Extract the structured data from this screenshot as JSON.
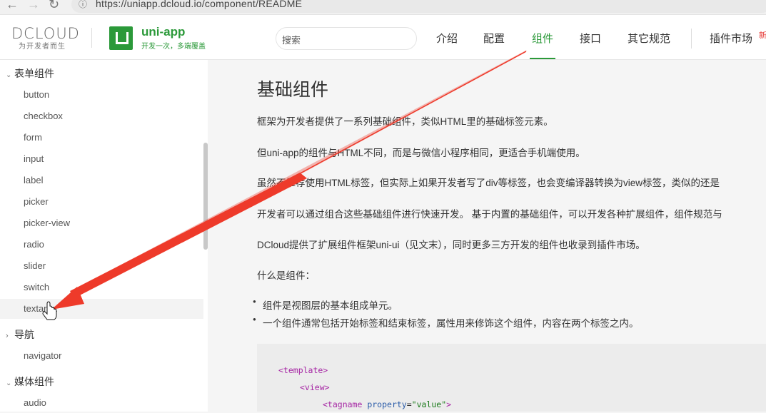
{
  "browser": {
    "url": "https://uniapp.dcloud.io/component/README"
  },
  "header": {
    "dcloud_logo": "DCLOUD",
    "dcloud_tagline": "为开发者而生",
    "uni_title": "uni-app",
    "uni_sub": "开发一次，多端覆盖",
    "search_placeholder": "搜索",
    "nav": [
      {
        "label": "介绍"
      },
      {
        "label": "配置"
      },
      {
        "label": "组件"
      },
      {
        "label": "接口"
      },
      {
        "label": "其它规范"
      },
      {
        "label": "插件市场"
      }
    ],
    "nav_badge": "新",
    "accent_color": "#2b9939"
  },
  "sidebar": {
    "groups": [
      {
        "title": "表单组件",
        "items": [
          "button",
          "checkbox",
          "form",
          "input",
          "label",
          "picker",
          "picker-view",
          "radio",
          "slider",
          "switch",
          "textarea"
        ]
      },
      {
        "title": "导航",
        "items": [
          "navigator"
        ]
      },
      {
        "title": "媒体组件",
        "items": [
          "audio"
        ]
      }
    ]
  },
  "main": {
    "title": "基础组件",
    "paragraphs": [
      "框架为开发者提供了一系列基础组件，类似HTML里的基础标签元素。",
      "但uni-app的组件与HTML不同，而是与微信小程序相同，更适合手机端使用。",
      "虽然不推荐使用HTML标签，但实际上如果开发者写了div等标签，也会变编译器转换为view标签，类似的还是",
      "开发者可以通过组合这些基础组件进行快速开发。 基于内置的基础组件，可以开发各种扩展组件，组件规范与",
      "DCloud提供了扩展组件框架uni-ui（见文末），同时更多三方开发的组件也收录到插件市场。",
      "什么是组件："
    ],
    "bullets": [
      "组件是视图层的基本组成单元。",
      "一个组件通常包括开始标签和结束标签，属性用来修饰这个组件，内容在两个标签之内。"
    ],
    "code": {
      "line1": "<template>",
      "line2": "<view>",
      "line3_tag": "<tagname",
      "line3_attr": "property",
      "line3_eq": "=",
      "line3_val": "\"value\"",
      "line3_end": ">"
    }
  },
  "annotation": {
    "arrow_color": "#ee3a2a"
  }
}
